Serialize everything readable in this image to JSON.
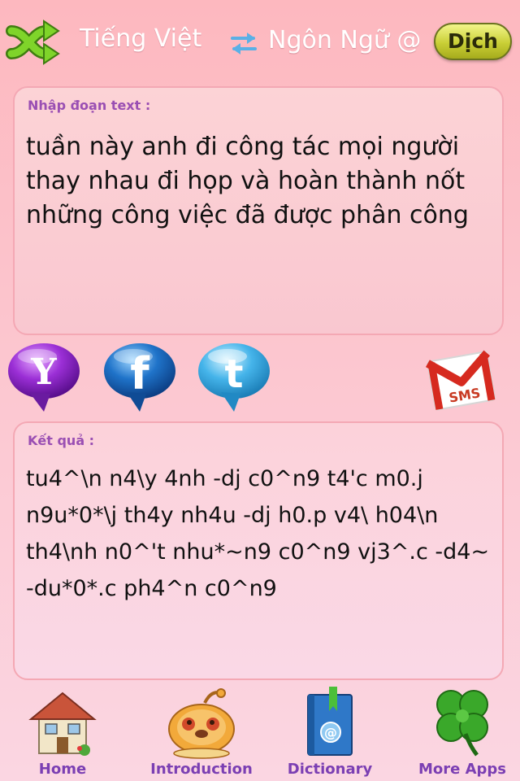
{
  "header": {
    "source_language": "Tiếng Việt",
    "target_language": "Ngôn Ngữ @",
    "translate_label": "Dịch"
  },
  "input": {
    "label": "Nhập đoạn text :",
    "text": "tuần này anh đi công tác mọi người thay nhau đi họp và hoàn thành nốt những công việc đã được phân công"
  },
  "output": {
    "label": "Kết quả :",
    "text": "tu4^\\n n4\\y 4nh -dj c0^n9 t4'c m0.j n9u*0*\\j th4y nh4u -dj h0.p v4\\ h04\\n th4\\nh n0^'t nhu*~n9 c0^n9 vj3^.c -d4~ -du*0*.c ph4^n c0^n9"
  },
  "share": {
    "yahoo_letter": "Y",
    "facebook_letter": "f",
    "twitter_letter": "t",
    "sms_label": "SMS"
  },
  "tabs": [
    {
      "label": "Home",
      "icon": "house-icon"
    },
    {
      "label": "Introduction",
      "icon": "mascot-icon"
    },
    {
      "label": "Dictionary",
      "icon": "book-icon"
    },
    {
      "label": "More Apps",
      "icon": "clover-icon"
    }
  ],
  "colors": {
    "background": "#fcc6cf",
    "label_purple": "#9a4fb3",
    "translate_button": "#c9cf36",
    "shuffle_green": "#6cc21e"
  }
}
